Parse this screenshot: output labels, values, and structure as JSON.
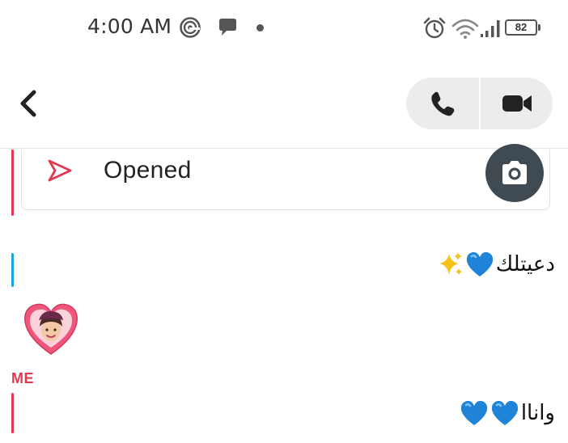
{
  "status_bar": {
    "time": "4:00 AM",
    "battery": "82",
    "icons": [
      "at-circle-icon",
      "chat-bubble-icon",
      "notification-dot-icon",
      "alarm-icon",
      "wifi-icon",
      "signal-icon",
      "battery-icon"
    ]
  },
  "header": {
    "back_icon": "chevron-left-icon",
    "call_icon": "phone-icon",
    "video_icon": "video-camera-icon"
  },
  "conversation": {
    "snap": {
      "status": "Opened",
      "status_icon": "sent-arrow-icon",
      "action_icon": "camera-icon"
    },
    "messages": [
      {
        "text": "دعيتلك",
        "emoji": [
          "blue-heart",
          "sparkles"
        ]
      },
      {
        "type": "bitmoji",
        "icon": "bitmoji-heart-avatar"
      },
      {
        "sender": "ME",
        "text": "واناا",
        "emoji": [
          "blue-heart",
          "blue-heart"
        ]
      }
    ]
  },
  "colors": {
    "accent_red": "#e0394f",
    "accent_blue": "#1fa3e0",
    "heart_blue": "#1f84d8",
    "camera_bg": "#3f4a52",
    "call_bg": "#ececec"
  }
}
